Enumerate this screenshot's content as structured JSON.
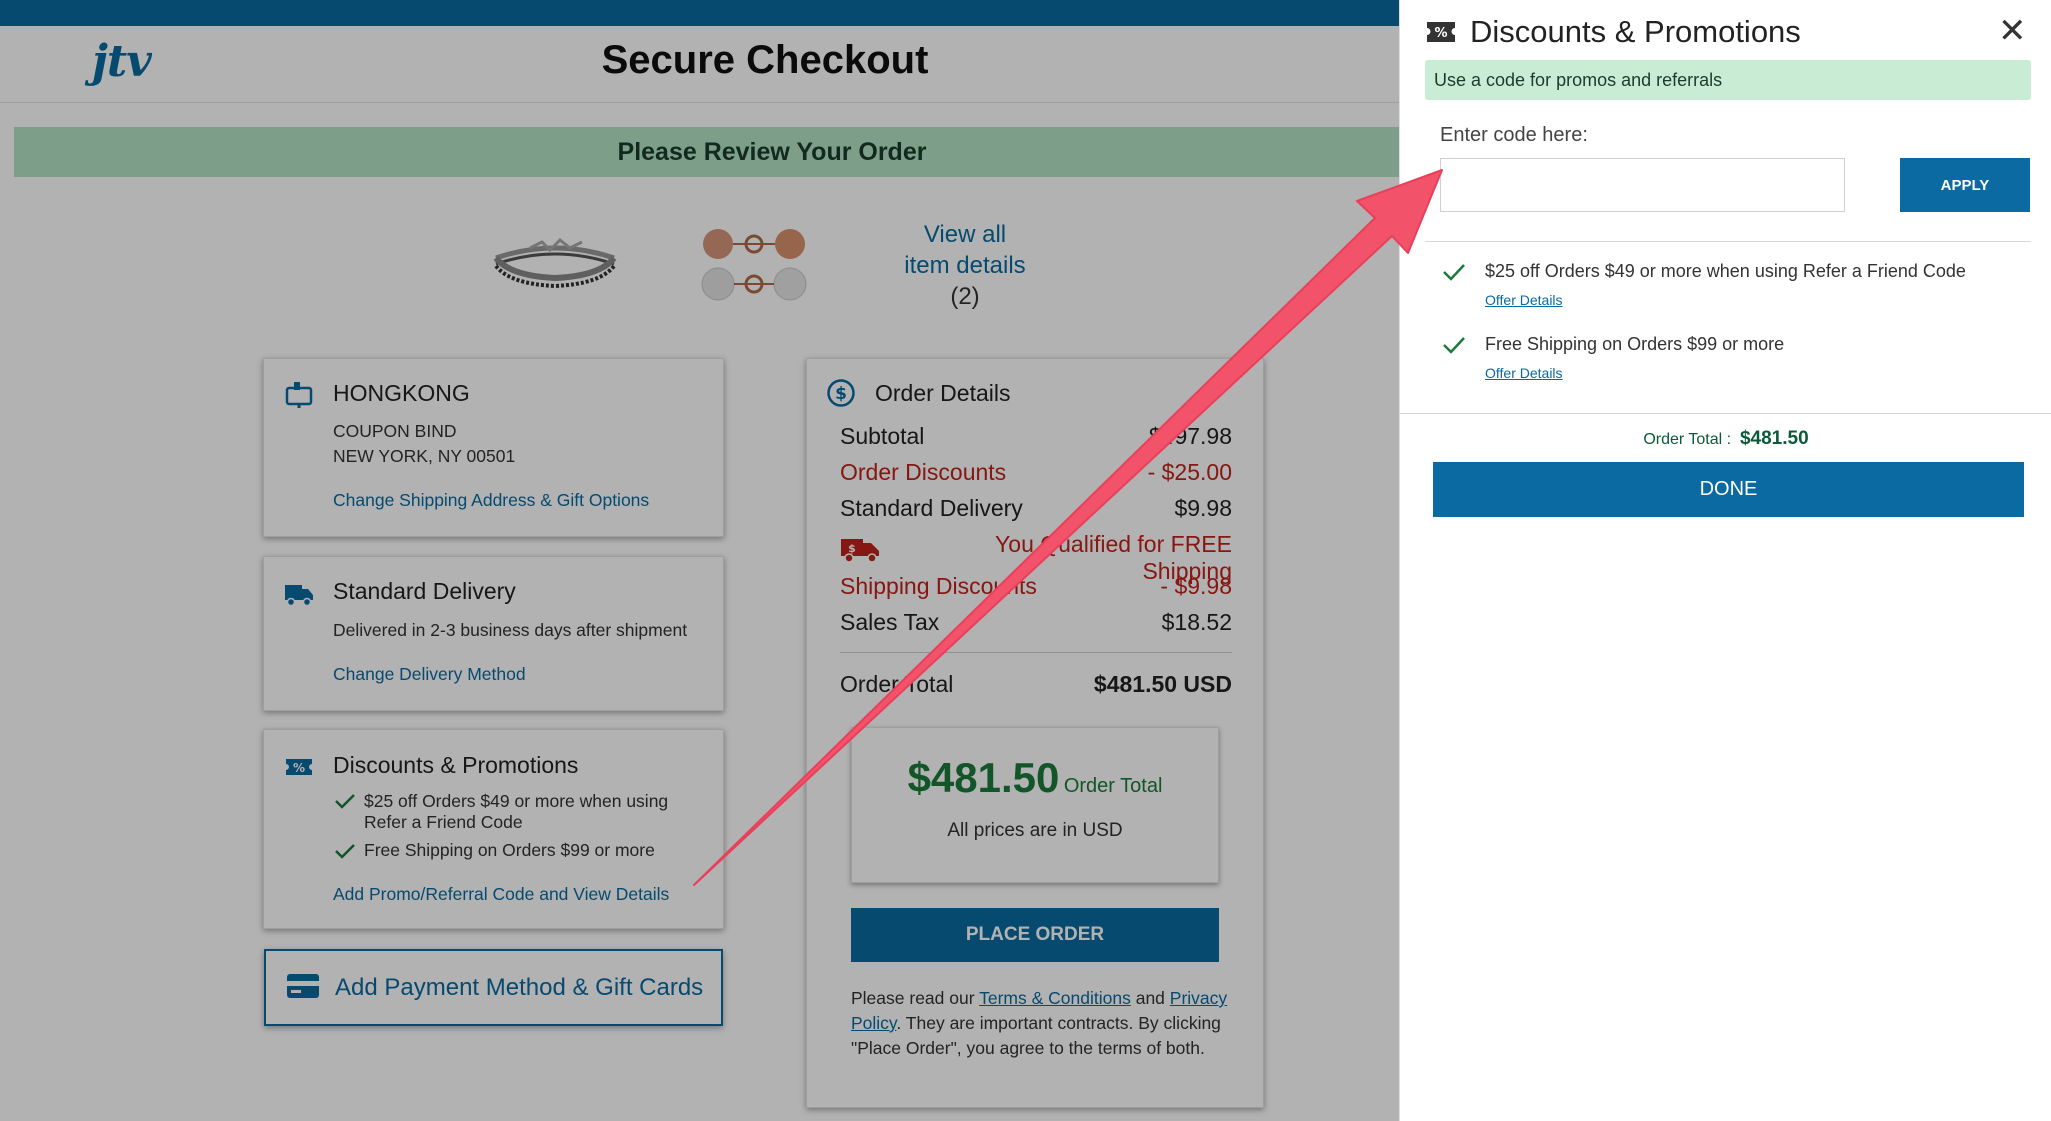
{
  "header": {
    "logo": "jtv",
    "title": "Secure Checkout"
  },
  "banner": "Please Review Your Order",
  "items": {
    "view_all_line1": "View all",
    "view_all_line2": "item details",
    "count": "(2)"
  },
  "shipping": {
    "name": "HONGKONG",
    "line1": "COUPON BIND",
    "line2": "NEW YORK, NY 00501",
    "link": "Change Shipping Address & Gift Options"
  },
  "delivery": {
    "title": "Standard Delivery",
    "desc": "Delivered in 2-3 business days after shipment",
    "link": "Change Delivery Method"
  },
  "promos_card": {
    "title": "Discounts & Promotions",
    "offer1_line1": "$25 off Orders $49 or more when using",
    "offer1_line2": "Refer a Friend Code",
    "offer2": "Free Shipping on Orders $99 or more",
    "link": "Add Promo/Referral Code and View Details"
  },
  "payment": {
    "label": "Add Payment Method & Gift Cards"
  },
  "order_details": {
    "title": "Order Details",
    "subtotal_label": "Subtotal",
    "subtotal_value": "$497.98",
    "discounts_label": "Order Discounts",
    "discounts_value": "- $25.00",
    "delivery_label": "Standard Delivery",
    "delivery_value": "$9.98",
    "free_shipping": "You Qualified for FREE Shipping",
    "ship_disc_label": "Shipping Discounts",
    "ship_disc_value": "- $9.98",
    "tax_label": "Sales Tax",
    "tax_value": "$18.52",
    "total_label": "Order Total",
    "total_value": "$481.50 USD",
    "big_total": "$481.50",
    "big_total_label": "Order Total",
    "usd_note": "All prices are in USD",
    "place_order": "PLACE ORDER",
    "terms_pre": "Please read our ",
    "terms_link": "Terms & Conditions",
    "terms_and": " and ",
    "privacy_link": "Privacy Policy",
    "terms_post": ". They are important contracts. By clicking \"Place Order\", you agree to the terms of both."
  },
  "panel": {
    "title": "Discounts & Promotions",
    "close": "✕",
    "banner": "Use a code for promos and referrals",
    "input_label": "Enter code here:",
    "input_value": "",
    "apply": "APPLY",
    "offers": [
      {
        "text": "$25 off Orders $49 or more when using Refer a Friend Code",
        "link": "Offer Details"
      },
      {
        "text": "Free Shipping on Orders $99 or more",
        "link": "Offer Details"
      }
    ],
    "total_label": "Order Total :",
    "total_value": "$481.50",
    "done": "DONE"
  },
  "colors": {
    "brand_blue": "#0a6aa1",
    "discount_red": "#c0221b",
    "total_green": "#1b7a3a",
    "arrow": "#f2536a"
  }
}
